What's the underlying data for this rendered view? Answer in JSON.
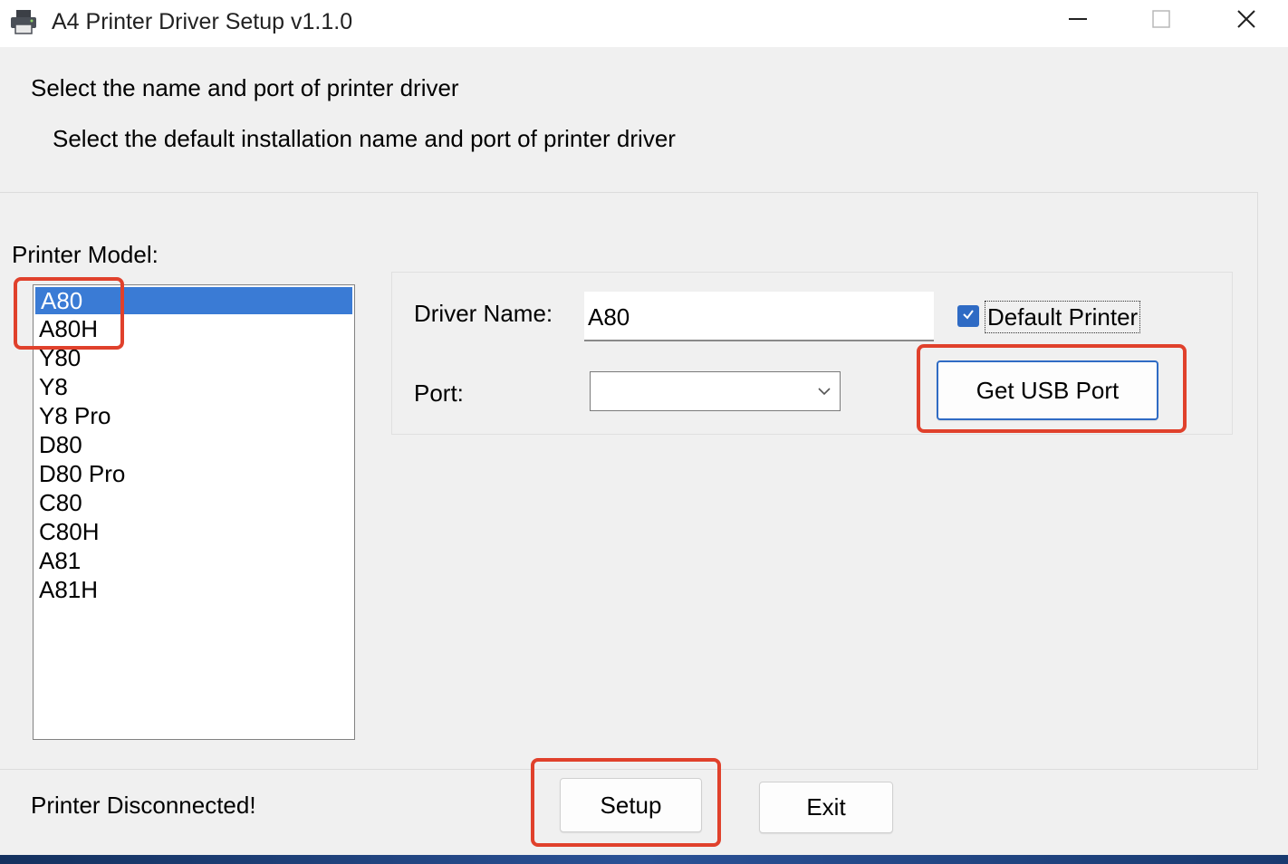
{
  "window": {
    "title": "A4 Printer Driver Setup v1.1.0",
    "icons": {
      "app": "printer-icon",
      "minimize": "minimize-icon",
      "maximize": "maximize-icon",
      "close": "close-icon"
    }
  },
  "header": {
    "heading": "Select the name and port of printer driver",
    "subheading": "Select the default installation name and port of printer driver"
  },
  "model": {
    "label": "Printer Model:",
    "items": [
      "A80",
      "A80H",
      "Y80",
      "Y8",
      "Y8 Pro",
      "D80",
      "D80 Pro",
      "C80",
      "C80H",
      "A81",
      "A81H"
    ],
    "selected": "A80"
  },
  "form": {
    "driver_name_label": "Driver Name:",
    "driver_name_value": "A80",
    "port_label": "Port:",
    "port_value": "",
    "default_printer_label": "Default Printer",
    "default_printer_checked": true,
    "get_usb_port_label": "Get USB Port"
  },
  "footer": {
    "status": "Printer Disconnected!",
    "setup_label": "Setup",
    "exit_label": "Exit"
  },
  "colors": {
    "accent": "#2f6bc4",
    "selection": "#3a7bd5",
    "highlight": "#e0412c"
  }
}
